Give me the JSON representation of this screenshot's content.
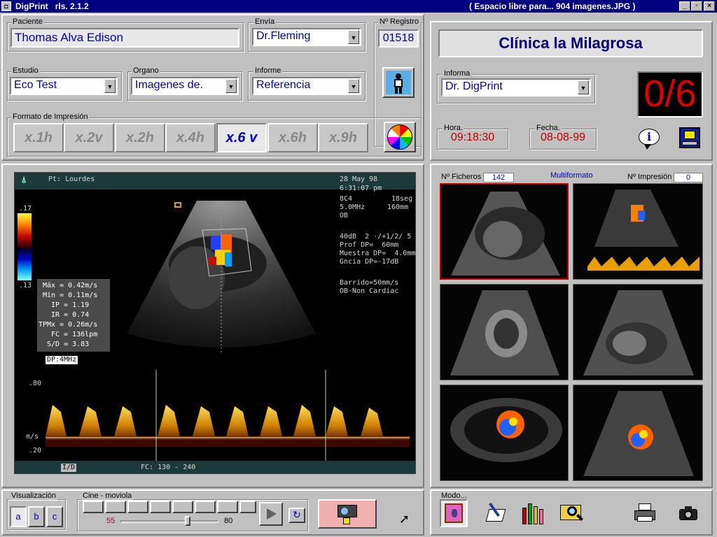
{
  "titlebar": {
    "app_name": "DigPrint",
    "version": "rls. 2.1.2",
    "free_space": "( Espacio libre para... 904  imagenes.JPG )"
  },
  "patient": {
    "label": "Paciente",
    "value": "Thomas Alva Edison"
  },
  "sender": {
    "label": "Envía",
    "value": "Dr.Fleming"
  },
  "registry": {
    "label": "Nº Registro",
    "value": "01518"
  },
  "study": {
    "label": "Estudio",
    "value": "Eco Test"
  },
  "organ": {
    "label": "Organo",
    "value": "Imagenes de."
  },
  "report": {
    "label": "Informe",
    "value": "Referencia"
  },
  "print_format": {
    "label": "Formato de Impresión",
    "buttons": [
      "x.1h",
      "x.2v",
      "x.2h",
      "x.4h",
      "x.6 v",
      "x.6h",
      "x.9h"
    ],
    "active": "x.6 v"
  },
  "clinic": {
    "name": "Clínica la Milagrosa",
    "informa_label": "Informa",
    "informa_value": "Dr. DigPrint",
    "counter": "0/6",
    "hora_label": "Hora.",
    "hora_value": "09:18:30",
    "fecha_label": "Fecha.",
    "fecha_value": "08-08-99"
  },
  "ultrasound": {
    "patient": "Pt: Lourdes",
    "date": "28 May 98",
    "time": "6:31:07 pm",
    "probe": "8C4",
    "fps": "18seg",
    "freq": "5.0MHz",
    "depth": "160mm",
    "mode": "OB",
    "params1": "40dB  2 ·/+1/2/ 5",
    "params2": "Prof DP=  60mm",
    "params3": "Muestra DP=  4.0mm",
    "params4": "Gncia DP=-17dB",
    "params5": "Barrido=50mm/s",
    "params6": "OB-Non Cardiac",
    "scale_top": ".17",
    "scale_bottom": ".13",
    "measurements": [
      "Máx = 0.42m/s",
      "Mín = 0.11m/s",
      "IP = 1.19",
      "IR = 0.74",
      "TPMx = 0.26m/s",
      "FC = 136lpm",
      "S/D = 3.83"
    ],
    "doppler_label": "DP:4MHz",
    "axis_top": ".80",
    "axis_unit": "m/s",
    "axis_bottom": ".20",
    "footer": "FC: 130 - 240"
  },
  "multiformat": {
    "files_label": "Nº Ficheros",
    "files_value": "142",
    "title": "Multiformato",
    "print_label": "Nº Impresión",
    "print_value": "0"
  },
  "visualizacion": {
    "label": "Visualización",
    "buttons": [
      "a",
      "b",
      "c"
    ]
  },
  "cine": {
    "label": "Cine - moviola",
    "min": "55",
    "max": "80",
    "slider_fraction": 0.7
  },
  "modo": {
    "label": "Modo..."
  },
  "colors": {
    "title_bg": "#000080",
    "counter_red": "#e00000",
    "value_blue": "#0000a8",
    "time_red": "#c00000"
  }
}
